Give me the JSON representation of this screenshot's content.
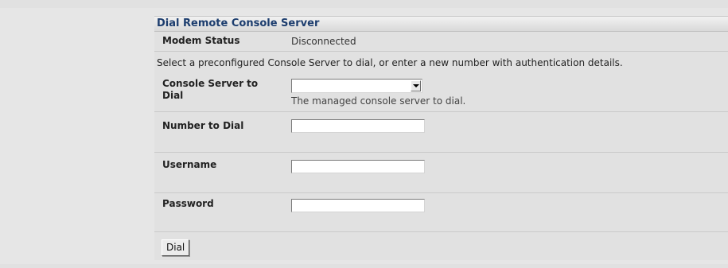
{
  "panel": {
    "title": "Dial Remote Console Server"
  },
  "modem_status": {
    "label": "Modem Status",
    "value": "Disconnected"
  },
  "instructions": "Select a preconfigured Console Server to dial, or enter a new number with authentication details.",
  "console_server": {
    "label_line1": "Console Server to",
    "label_line2": "Dial",
    "selected": "",
    "help": "The managed console server to dial."
  },
  "number_to_dial": {
    "label": "Number to Dial",
    "value": ""
  },
  "username": {
    "label": "Username",
    "value": ""
  },
  "password": {
    "label": "Password",
    "value": ""
  },
  "dial_button": {
    "label": "Dial"
  }
}
